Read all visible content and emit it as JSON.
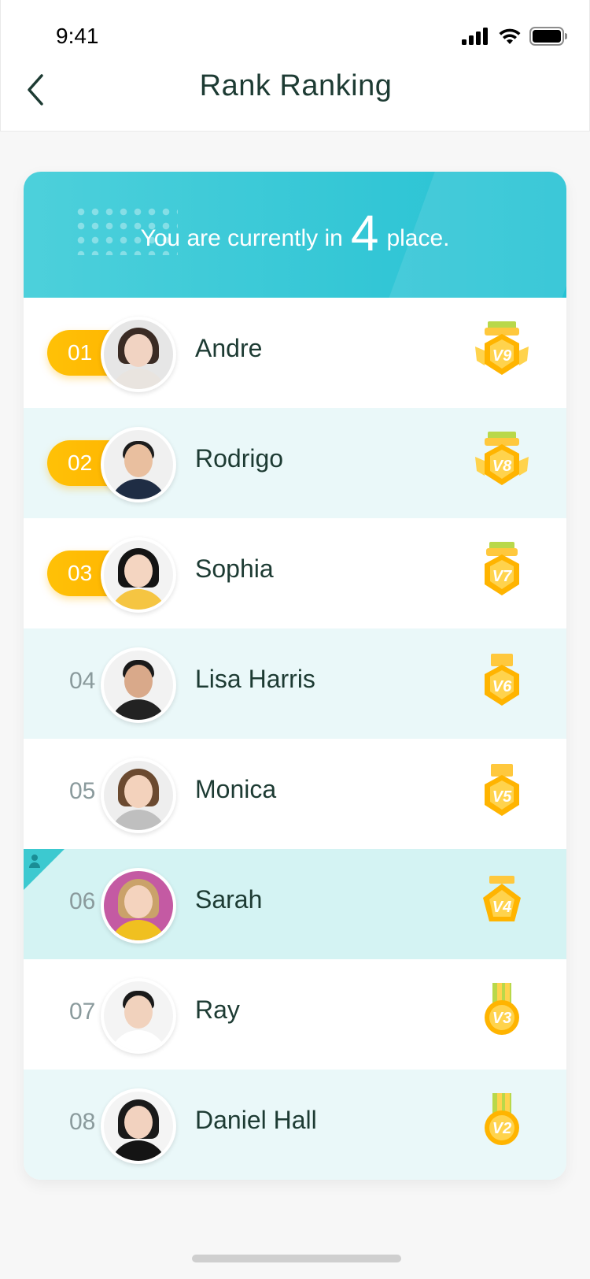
{
  "status_bar": {
    "time": "9:41"
  },
  "header": {
    "title": "Rank Ranking"
  },
  "banner": {
    "prefix": "You are currently in",
    "rank": "4",
    "suffix": "place."
  },
  "colors": {
    "accent": "#35c7d6",
    "pill": "#ffb400",
    "highlight_row": "#d4f3f3",
    "alt_row": "#eaf8f9"
  },
  "rankings": [
    {
      "rank": "01",
      "name": "Andre",
      "level": "V9",
      "medal": "winged-gold-medal-icon",
      "top": true
    },
    {
      "rank": "02",
      "name": "Rodrigo",
      "level": "V8",
      "medal": "winged-gold-medal-icon",
      "top": true
    },
    {
      "rank": "03",
      "name": "Sophia",
      "level": "V7",
      "medal": "gold-medal-icon",
      "top": true
    },
    {
      "rank": "04",
      "name": "Lisa Harris",
      "level": "V6",
      "medal": "hexagon-medal-icon",
      "top": false
    },
    {
      "rank": "05",
      "name": "Monica",
      "level": "V5",
      "medal": "hexagon-medal-icon",
      "top": false
    },
    {
      "rank": "06",
      "name": "Sarah",
      "level": "V4",
      "medal": "pentagon-medal-icon",
      "top": false,
      "current_user": true
    },
    {
      "rank": "07",
      "name": "Ray",
      "level": "V3",
      "medal": "round-medal-icon",
      "top": false
    },
    {
      "rank": "08",
      "name": "Daniel Hall",
      "level": "V2",
      "medal": "round-medal-icon",
      "top": false
    }
  ]
}
